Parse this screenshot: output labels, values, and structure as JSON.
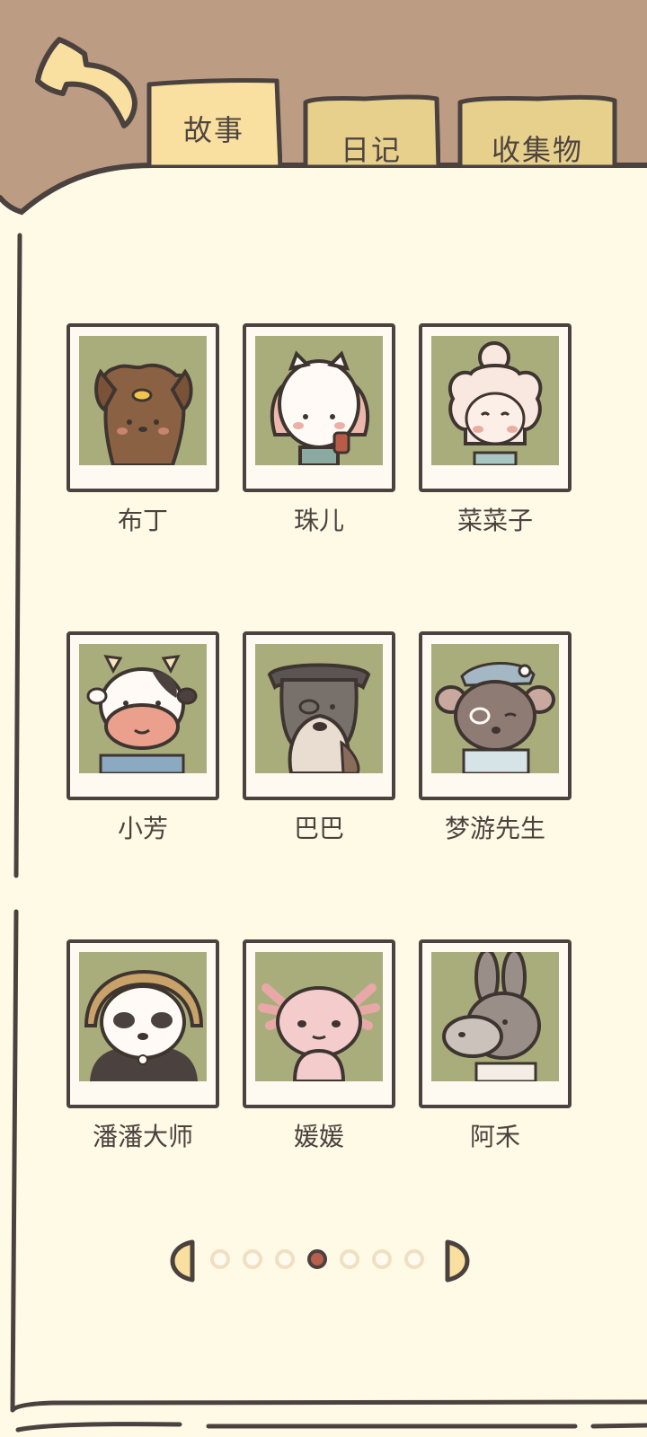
{
  "tabs": [
    {
      "label": "故事",
      "active": true
    },
    {
      "label": "日记",
      "active": false
    },
    {
      "label": "收集物",
      "active": false
    }
  ],
  "characters": [
    {
      "name": "布丁",
      "animal": "dog-icon"
    },
    {
      "name": "珠儿",
      "animal": "cat-icon"
    },
    {
      "name": "菜菜子",
      "animal": "sheep-icon"
    },
    {
      "name": "小芳",
      "animal": "cow-icon"
    },
    {
      "name": "巴巴",
      "animal": "schnauzer-icon"
    },
    {
      "name": "梦游先生",
      "animal": "mouse-icon"
    },
    {
      "name": "潘潘大师",
      "animal": "panda-icon"
    },
    {
      "name": "媛媛",
      "animal": "axolotl-icon"
    },
    {
      "name": "阿禾",
      "animal": "donkey-icon"
    }
  ],
  "pagination": {
    "current_page": 4,
    "total_pages": 7
  },
  "colors": {
    "background": "#bd9c84",
    "paper": "#fffae6",
    "active_tab": "#f9e0a0",
    "inactive_tab": "#e6d08c",
    "outline": "#4b423f",
    "photo_bg": "#a9ad7c",
    "active_dot": "#b7604e"
  }
}
